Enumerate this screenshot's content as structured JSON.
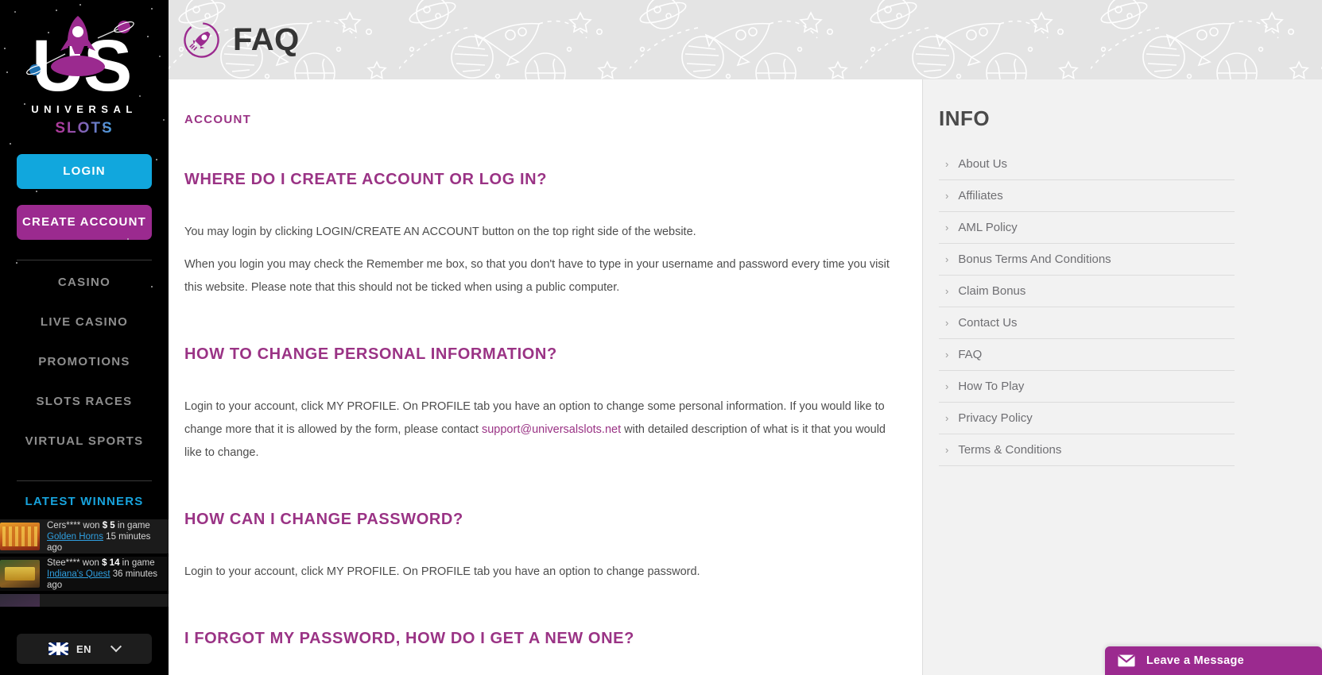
{
  "brand": {
    "logo_line1": "UNIVERSAL",
    "logo_line2": "SLOTS",
    "logo_icon": "rocket-logo"
  },
  "sidebar": {
    "login_label": "LOGIN",
    "create_account_label": "CREATE ACCOUNT",
    "nav": [
      {
        "label": "CASINO"
      },
      {
        "label": "LIVE CASINO"
      },
      {
        "label": "PROMOTIONS"
      },
      {
        "label": "SLOTS RACES"
      },
      {
        "label": "VIRTUAL SPORTS"
      }
    ],
    "winners_title": "LATEST WINNERS",
    "winners": [
      {
        "player": "Cers****",
        "won_word": "won",
        "amount": "$ 5",
        "in_game": "in game",
        "game": "Golden Horns",
        "time": "15 minutes ago"
      },
      {
        "player": "Stee****",
        "won_word": "won",
        "amount": "$ 14",
        "in_game": "in game",
        "game": "Indiana's Quest",
        "time": "36 minutes ago"
      }
    ],
    "language": {
      "code": "EN",
      "flag": "uk-flag-icon",
      "chevron": "chevron-down-icon"
    }
  },
  "header": {
    "title": "FAQ",
    "icon": "rocket-circle-icon"
  },
  "faq": {
    "section_title": "ACCOUNT",
    "entries": [
      {
        "question": "WHERE DO I CREATE ACCOUNT OR LOG IN?",
        "paragraphs": [
          "You may login by clicking LOGIN/CREATE AN ACCOUNT button on the top right side of the website.",
          "When you login you may check the Remember me box, so that you don't have to type in your username and password every time you visit this website. Please note that this should not be ticked when using a public computer."
        ]
      },
      {
        "question": "HOW TO CHANGE PERSONAL INFORMATION?",
        "paragraph_before": "Login to your account, click MY PROFILE. On PROFILE tab you have an option to change some personal information. If you would like to change more that it is allowed by the form, please contact ",
        "link": "support@universalslots.net",
        "paragraph_after": " with detailed description of what is it that you would like to change."
      },
      {
        "question": "HOW CAN I CHANGE PASSWORD?",
        "paragraphs": [
          "Login to your account, click MY PROFILE. On PROFILE tab you have an option to change password."
        ]
      },
      {
        "question": "I FORGOT MY PASSWORD, HOW DO I GET A NEW ONE?",
        "paragraphs": []
      }
    ]
  },
  "info": {
    "title": "INFO",
    "items": [
      {
        "label": "About Us"
      },
      {
        "label": "Affiliates"
      },
      {
        "label": "AML Policy"
      },
      {
        "label": "Bonus Terms And Conditions"
      },
      {
        "label": "Claim Bonus"
      },
      {
        "label": "Contact Us"
      },
      {
        "label": "FAQ"
      },
      {
        "label": "How To Play"
      },
      {
        "label": "Privacy Policy"
      },
      {
        "label": "Terms & Conditions"
      }
    ],
    "caret": "›"
  },
  "chat": {
    "label": "Leave a Message",
    "icon": "envelope-icon"
  },
  "colors": {
    "accent_purple": "#9b2a8f",
    "accent_blue": "#11a7dd",
    "heading_purple": "#9a3385",
    "sidebar_bg": "#000000",
    "header_bg": "#e4e4e4",
    "info_bg": "#f2f2f2"
  }
}
